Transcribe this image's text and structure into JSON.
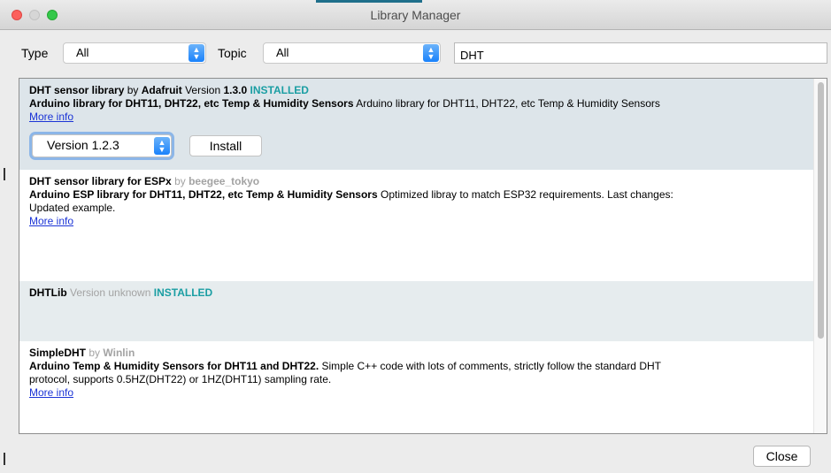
{
  "window": {
    "title": "Library Manager"
  },
  "filters": {
    "type_label": "Type",
    "type_value": "All",
    "topic_label": "Topic",
    "topic_value": "All",
    "search_value": "DHT"
  },
  "libraries": [
    {
      "name": "DHT sensor library",
      "by": "by",
      "author": "Adafruit",
      "version_label": "Version",
      "version": "1.3.0",
      "status": "INSTALLED",
      "sentence": "Arduino library for DHT11, DHT22, etc Temp & Humidity Sensors",
      "description": "Arduino library for DHT11, DHT22, etc Temp & Humidity Sensors",
      "more_info": "More info",
      "selected_version": "Version 1.2.3",
      "install_label": "Install"
    },
    {
      "name": "DHT sensor library for ESPx",
      "by": "by",
      "author": "beegee_tokyo",
      "sentence": "Arduino ESP library for DHT11, DHT22, etc Temp & Humidity Sensors",
      "description": "Optimized libray to match ESP32 requirements. Last changes:",
      "description_line2": "Updated example.",
      "more_info": "More info"
    },
    {
      "name": "DHTLib",
      "version_text": "Version unknown",
      "status": "INSTALLED"
    },
    {
      "name": "SimpleDHT",
      "by": "by",
      "author": "Winlin",
      "sentence": "Arduino Temp & Humidity Sensors for DHT11 and DHT22.",
      "description": "Simple C++ code with lots of comments, strictly follow the standard DHT",
      "description_line2": "protocol, supports 0.5HZ(DHT22) or 1HZ(DHT11) sampling rate.",
      "more_info": "More info"
    }
  ],
  "footer": {
    "close_label": "Close"
  }
}
